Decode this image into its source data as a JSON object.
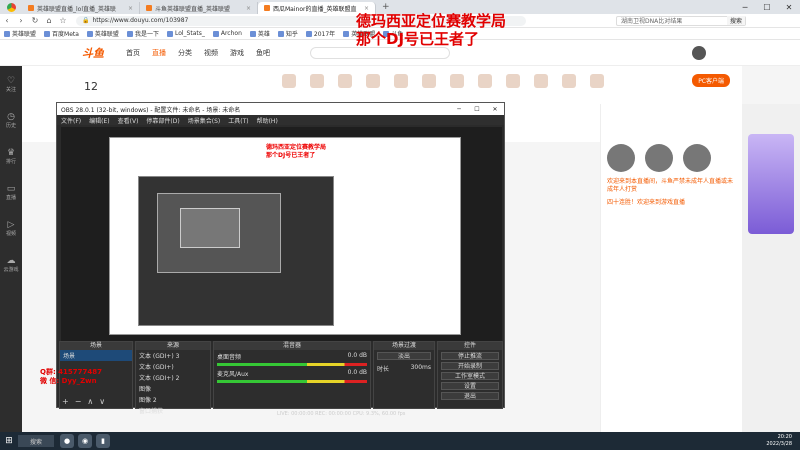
{
  "browser": {
    "tabs": [
      {
        "label": "英雄联盟直播_lol直播_英雄联"
      },
      {
        "label": "斗鱼英雄联盟直播_英雄联盟"
      },
      {
        "label": "西瓜Mainor的直播_英雄联盟直"
      }
    ],
    "address": "https://www.douyu.com/103987",
    "search_text": "湖南卫视DNA比对结果",
    "search_button": "搜索",
    "bookmarks": [
      "英雄联盟",
      "百度Meta",
      "英雄联盟",
      "我是一下",
      "Lol_Stats_",
      "Archon",
      "英雄",
      "知乎",
      "2017年",
      "英雄联盟",
      "斗鱼"
    ]
  },
  "douyu": {
    "logo_text": "斗鱼",
    "nav": [
      "首页",
      "直播",
      "分类",
      "视频",
      "游戏",
      "鱼吧"
    ],
    "room_number": "12",
    "pc_button": "PC客户端",
    "sidebar_items": [
      "关注",
      "历史",
      "排行",
      "直播",
      "视频",
      "云游戏"
    ],
    "chat_messages": [
      "欢迎来到本直播间，斗鱼严禁未成年人直播或未成年人打赏",
      "四十连胜！欢迎来到游戏直播"
    ]
  },
  "obs": {
    "title": "OBS 28.0.1 (32-bit, windows) - 配置文件: 未命名 - 场景: 未命名",
    "menu": [
      "文件(F)",
      "编辑(E)",
      "查看(V)",
      "停靠部件(D)",
      "场景集合(S)",
      "工具(T)",
      "帮助(H)"
    ],
    "docks": {
      "scenes": {
        "title": "场景",
        "items": [
          "场景"
        ]
      },
      "sources": {
        "title": "来源",
        "items": [
          "文本 (GDI+) 3",
          "文本 (GDI+)",
          "文本 (GDI+) 2",
          "图像",
          "图像 2",
          "窗口捕获"
        ]
      },
      "mixer": {
        "title": "混音器",
        "channels": [
          {
            "name": "桌面音频",
            "db": "0.0 dB"
          },
          {
            "name": "麦克风/Aux",
            "db": "0.0 dB"
          }
        ]
      },
      "transitions": {
        "title": "场景过渡",
        "type": "淡出",
        "duration_label": "时长",
        "duration": "300ms"
      },
      "controls": {
        "title": "控件",
        "buttons": [
          "停止推流",
          "开始录制",
          "工作室模式",
          "设置",
          "退出"
        ]
      }
    },
    "status": "LIVE: 00:00:00   REC: 00:00:00   CPU: 9.3%, 60.00 fps"
  },
  "overlay": {
    "title_line1": "德玛西亚定位赛教学局",
    "title_line2": "那个DJ号已王者了",
    "qq_line1": "Q群: 415777487",
    "qq_line2": "微 信: Dyy_Zwn"
  },
  "taskbar": {
    "search": "搜索",
    "time": "20:20",
    "date": "2022/3/28"
  }
}
